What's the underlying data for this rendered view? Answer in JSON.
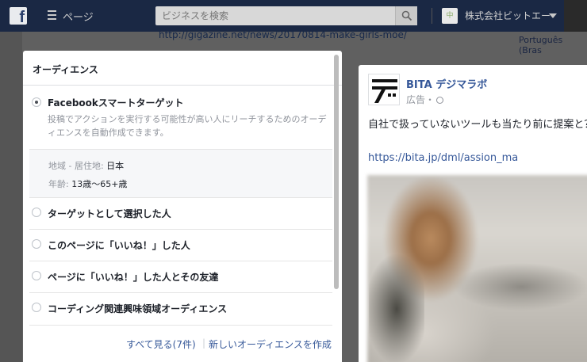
{
  "topbar": {
    "pages_label": "ページ",
    "search_placeholder": "ビジネスを検索",
    "page_name": "株式会社ビットエー",
    "page_avatar_text": "中"
  },
  "background": {
    "url_text": "http://gigazine.net/news/20170814-make-girls-moe/",
    "right_text": "Português (Bras"
  },
  "audience": {
    "title": "オーディエンス",
    "options": [
      {
        "label": "Facebookスマートターゲット",
        "selected": true,
        "description": "投稿でアクションを実行する可能性が高い人にリーチするためのオーディエンスを自動作成できます。"
      },
      {
        "label": "ターゲットとして選択した人",
        "selected": false
      },
      {
        "label": "このページに「いいね！」した人",
        "selected": false
      },
      {
        "label": "ページに「いいね！」した人とその友達",
        "selected": false
      },
      {
        "label": "コーディング関連興味領域オーディエンス",
        "selected": false
      }
    ],
    "details": {
      "location_key": "地域 - 居住地:",
      "location_val": "日本",
      "age_key": "年齢:",
      "age_val": "13歳〜65+歳"
    },
    "footer": {
      "see_all": "すべて見る(7件)",
      "separator": "|",
      "create_new": "新しいオーディエンスを作成"
    }
  },
  "ad_preview": {
    "page_name": "BITA デジマラボ",
    "sponsored": "広告・",
    "text": "自社で扱っていないツールも当たり前に提案と？",
    "link": "https://bita.jp/dml/assion_ma"
  },
  "colors": {
    "fb_blue": "#3b5998",
    "link": "#365899",
    "text": "#1d2129",
    "muted": "#90949c"
  }
}
